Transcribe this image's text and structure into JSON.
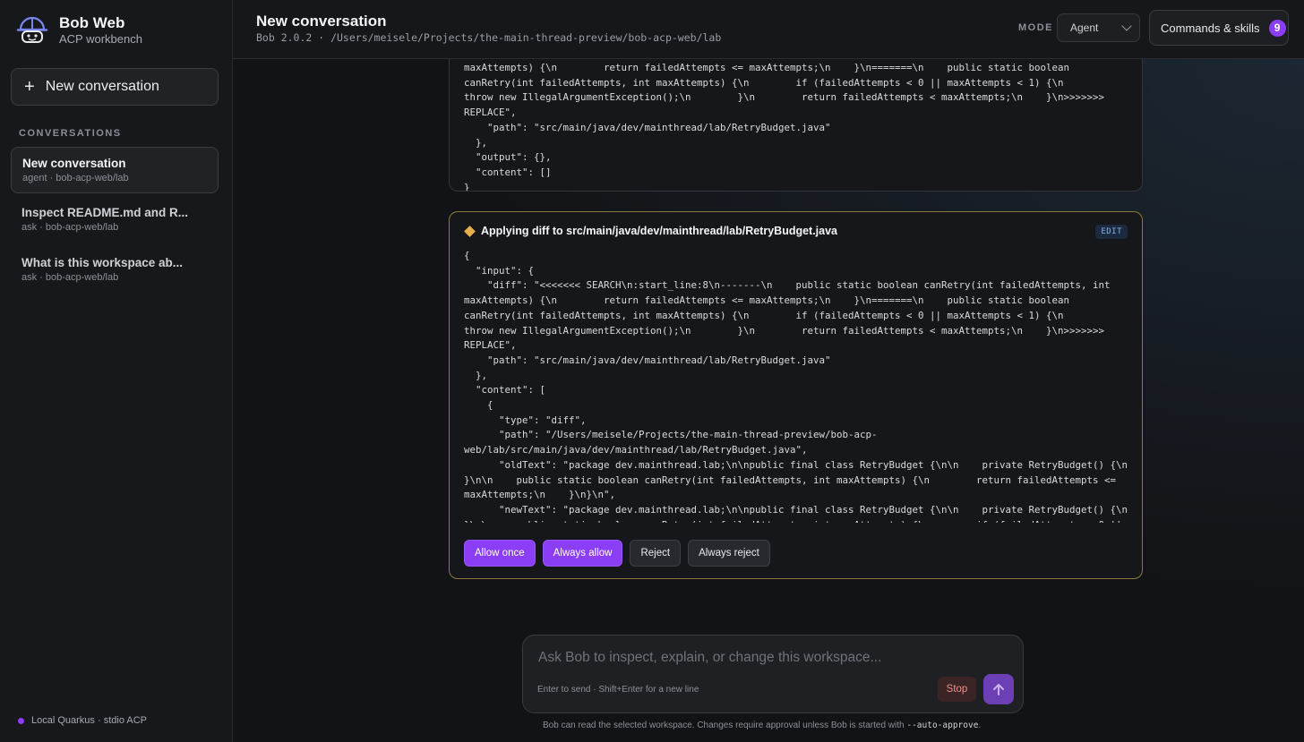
{
  "brand": {
    "title": "Bob Web",
    "subtitle": "ACP workbench"
  },
  "sidebar": {
    "new_conversation": "New conversation",
    "section_label": "CONVERSATIONS",
    "conversations": [
      {
        "title": "New conversation",
        "meta": "agent · bob-acp-web/lab",
        "active": true
      },
      {
        "title": "Inspect README.md and R...",
        "meta": "ask · bob-acp-web/lab",
        "active": false
      },
      {
        "title": "What is this workspace ab...",
        "meta": "ask · bob-acp-web/lab",
        "active": false
      }
    ],
    "footer": "Local Quarkus · stdio ACP"
  },
  "header": {
    "title": "New conversation",
    "subtitle": "Bob 2.0.2 · /Users/meisele/Projects/the-main-thread-preview/bob-acp-web/lab",
    "mode_label": "MODE",
    "mode_value": "Agent",
    "commands_label": "Commands & skills",
    "commands_count": "9"
  },
  "card1": {
    "code": "maxAttempts) {\\n        return failedAttempts <= maxAttempts;\\n    }\\n=======\\n    public static boolean\ncanRetry(int failedAttempts, int maxAttempts) {\\n        if (failedAttempts < 0 || maxAttempts < 1) {\\n\nthrow new IllegalArgumentException();\\n        }\\n        return failedAttempts < maxAttempts;\\n    }\\n>>>>>>>\nREPLACE\",\n    \"path\": \"src/main/java/dev/mainthread/lab/RetryBudget.java\"\n  },\n  \"output\": {},\n  \"content\": []\n}"
  },
  "card2": {
    "title": "Applying diff to src/main/java/dev/mainthread/lab/RetryBudget.java",
    "badge": "EDIT",
    "code": "{\n  \"input\": {\n    \"diff\": \"<<<<<<< SEARCH\\n:start_line:8\\n-------\\n    public static boolean canRetry(int failedAttempts, int\nmaxAttempts) {\\n        return failedAttempts <= maxAttempts;\\n    }\\n=======\\n    public static boolean\ncanRetry(int failedAttempts, int maxAttempts) {\\n        if (failedAttempts < 0 || maxAttempts < 1) {\\n\nthrow new IllegalArgumentException();\\n        }\\n        return failedAttempts < maxAttempts;\\n    }\\n>>>>>>>\nREPLACE\",\n    \"path\": \"src/main/java/dev/mainthread/lab/RetryBudget.java\"\n  },\n  \"content\": [\n    {\n      \"type\": \"diff\",\n      \"path\": \"/Users/meisele/Projects/the-main-thread-preview/bob-acp-\nweb/lab/src/main/java/dev/mainthread/lab/RetryBudget.java\",\n      \"oldText\": \"package dev.mainthread.lab;\\n\\npublic final class RetryBudget {\\n\\n    private RetryBudget() {\\n\n}\\n\\n    public static boolean canRetry(int failedAttempts, int maxAttempts) {\\n        return failedAttempts <=\nmaxAttempts;\\n    }\\n}\\n\",\n      \"newText\": \"package dev.mainthread.lab;\\n\\npublic final class RetryBudget {\\n\\n    private RetryBudget() {\\n\n}\\n\\n    public static boolean canRetry(int failedAttempts, int maxAttempts) {\\n        if (failedAttempts < 0 ||",
    "actions": [
      "Allow once",
      "Always allow",
      "Reject",
      "Always reject"
    ]
  },
  "composer": {
    "placeholder": "Ask Bob to inspect, explain, or change this workspace...",
    "hint": "Enter to send · Shift+Enter for a new line",
    "stop_label": "Stop"
  },
  "footer_note": {
    "before": "Bob can read the selected workspace. Changes require approval unless Bob is started with",
    "flag": "--auto-approve",
    "after": "."
  },
  "colors": {
    "accent": "#8b3ef5",
    "warning_border": "#8a7a3d",
    "diamond": "#e8b04a"
  },
  "icons": {
    "logo": "robot-helmet-icon",
    "send": "arrow-up-icon",
    "edit_marker": "diamond-icon"
  }
}
